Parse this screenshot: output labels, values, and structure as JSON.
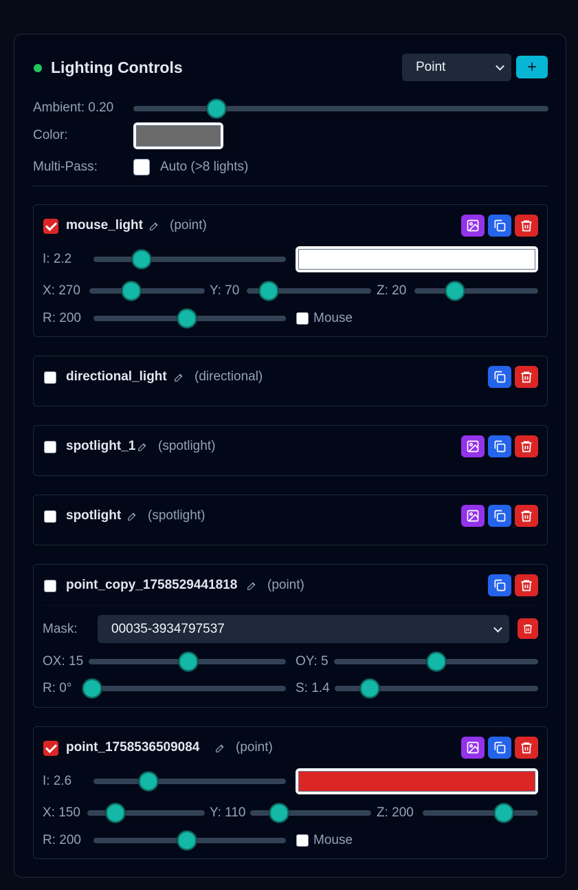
{
  "header": {
    "title": "Lighting Controls",
    "type_select": "Point",
    "add_label": "+"
  },
  "globals": {
    "ambient_label": "Ambient: 0.20",
    "ambient_value": 0.2,
    "color_label": "Color:",
    "color_value": "#6b6b6b",
    "multipass_label": "Multi-Pass:",
    "multipass_checked": false,
    "multipass_option": "Auto (>8 lights)"
  },
  "lights": [
    {
      "name": "mouse_light",
      "type": "(point)",
      "enabled": true,
      "intensity_label": "I: 2.2",
      "color": "#ffffff",
      "x_label": "X: 270",
      "y_label": "Y: 70",
      "z_label": "Z: 20",
      "radius_label": "R: 200",
      "mouse_label": "Mouse",
      "mouse_checked": false
    },
    {
      "name": "directional_light",
      "type": "(directional)",
      "enabled": false
    },
    {
      "name": "spotlight_1",
      "type": "(spotlight)",
      "enabled": false
    },
    {
      "name": "spotlight",
      "type": "(spotlight)",
      "enabled": false
    },
    {
      "name": "point_copy_1758529441818",
      "type": "(point)",
      "enabled": false,
      "mask_label": "Mask:",
      "mask_value": "00035-3934797537",
      "ox_label": "OX: 15",
      "oy_label": "OY: 5",
      "rot_label": "R: 0°",
      "scale_label": "S: 1.4"
    },
    {
      "name": "point_1758536509084",
      "type": "(point)",
      "enabled": true,
      "intensity_label": "I: 2.6",
      "color": "#dc2626",
      "x_label": "X: 150",
      "y_label": "Y: 110",
      "z_label": "Z: 200",
      "radius_label": "R: 200",
      "mouse_label": "Mouse",
      "mouse_checked": false
    }
  ],
  "icons": {
    "edit": "pencil-icon",
    "image": "image-icon",
    "duplicate": "copy-icon",
    "delete": "trash-icon",
    "dropdown": "chevron-down-icon",
    "status": "status-dot-icon"
  },
  "colors": {
    "accent": "#06b6d4",
    "slider": "#14b8a6",
    "status_on": "#22c55e",
    "image_button": "#9333ea",
    "duplicate_button": "#2563eb",
    "delete_button": "#dc2626"
  }
}
